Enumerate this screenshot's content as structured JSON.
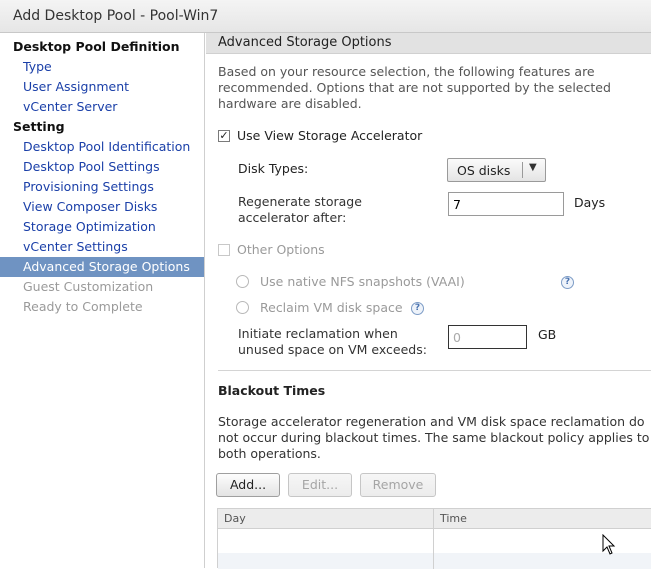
{
  "window": {
    "title": "Add Desktop Pool - Pool-Win7"
  },
  "sidebar": {
    "sections": [
      {
        "label": "Desktop Pool Definition"
      },
      {
        "label": "Setting"
      }
    ],
    "items": [
      {
        "label": "Type",
        "state": "link"
      },
      {
        "label": "User Assignment",
        "state": "link"
      },
      {
        "label": "vCenter Server",
        "state": "link"
      },
      {
        "label": "Desktop Pool Identification",
        "state": "link"
      },
      {
        "label": "Desktop Pool Settings",
        "state": "link"
      },
      {
        "label": "Provisioning Settings",
        "state": "link"
      },
      {
        "label": "View Composer Disks",
        "state": "link"
      },
      {
        "label": "Storage Optimization",
        "state": "link"
      },
      {
        "label": "vCenter Settings",
        "state": "link"
      },
      {
        "label": "Advanced Storage Options",
        "state": "selected"
      },
      {
        "label": "Guest Customization",
        "state": "disabled"
      },
      {
        "label": "Ready to Complete",
        "state": "disabled"
      }
    ]
  },
  "main": {
    "header": "Advanced Storage Options",
    "intro_lines": [
      "Based on your resource selection, the following features are",
      "recommended. Options that are not supported by the selected",
      "hardware are disabled."
    ],
    "use_view_storage_accelerator": {
      "label": "Use View Storage Accelerator",
      "checked": true,
      "check_glyph": "✓"
    },
    "disk_types": {
      "label": "Disk Types:",
      "value": "OS disks",
      "arrow": "▼"
    },
    "regenerate": {
      "label_lines": [
        "Regenerate storage",
        "accelerator after:"
      ],
      "value": "7",
      "unit": "Days"
    },
    "other_options": {
      "label": "Other Options",
      "checked": false
    },
    "native_nfs": {
      "label": "Use native NFS snapshots (VAAI)",
      "help": "?"
    },
    "reclaim": {
      "label": "Reclaim VM disk space",
      "help": "?"
    },
    "initiate": {
      "label_lines": [
        "Initiate reclamation when",
        "unused space on VM exceeds:"
      ],
      "value": "0",
      "unit": "GB"
    },
    "blackout": {
      "title": "Blackout Times",
      "desc_lines": [
        "Storage accelerator regeneration and VM disk space reclamation do",
        "not occur during blackout times. The same blackout policy applies to",
        "both operations."
      ],
      "buttons": {
        "add": "Add...",
        "edit": "Edit...",
        "remove": "Remove"
      },
      "table": {
        "columns": [
          "Day",
          "Time"
        ],
        "rows": []
      }
    }
  },
  "colors": {
    "selection": "#6f93c2",
    "link": "#1a3fa8",
    "disabled_text": "#9a9a9a"
  }
}
